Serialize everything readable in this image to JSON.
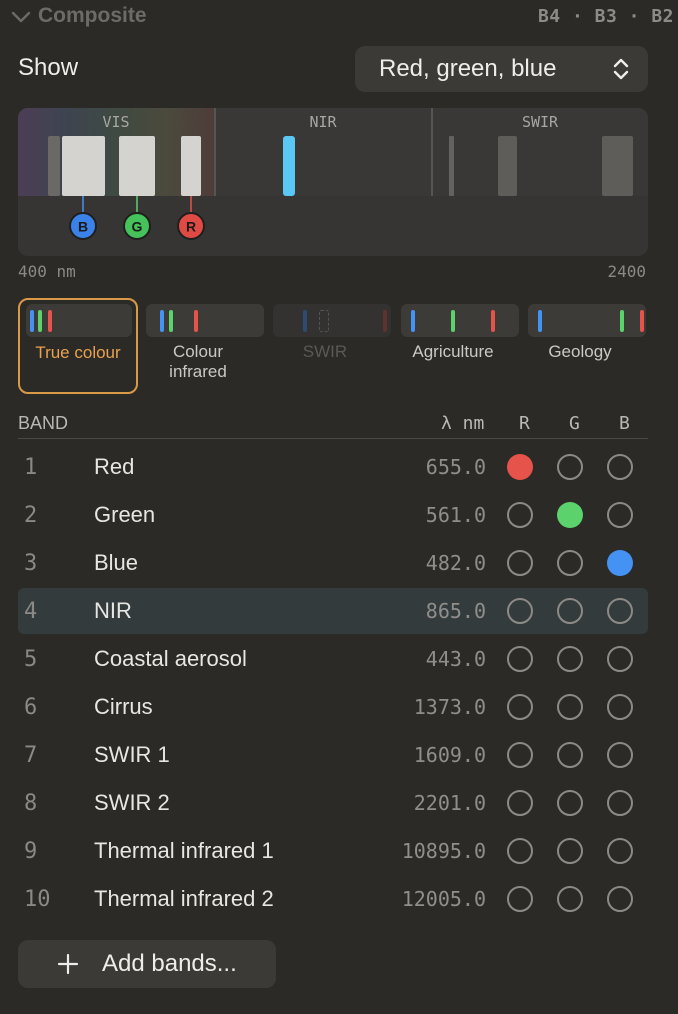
{
  "header": {
    "title": "Composite",
    "bands_summary": "B4 · B3 · B2"
  },
  "show": {
    "label": "Show",
    "selected": "Red, green, blue"
  },
  "spectrum": {
    "regions": [
      "VIS",
      "NIR",
      "SWIR"
    ],
    "min_label": "400 nm",
    "max_label": "2400",
    "channel_markers": [
      "B",
      "G",
      "R"
    ]
  },
  "presets": [
    {
      "label": "True colour",
      "active": true
    },
    {
      "label": "Colour infrared",
      "active": false
    },
    {
      "label": "SWIR",
      "active": false,
      "disabled": true
    },
    {
      "label": "Agriculture",
      "active": false
    },
    {
      "label": "Geology",
      "active": false
    }
  ],
  "table": {
    "headers": {
      "band": "BAND",
      "wavelength": "λ nm",
      "r": "R",
      "g": "G",
      "b": "B"
    },
    "rows": [
      {
        "num": "1",
        "name": "Red",
        "wl": "655.0",
        "assigned": "R"
      },
      {
        "num": "2",
        "name": "Green",
        "wl": "561.0",
        "assigned": "G"
      },
      {
        "num": "3",
        "name": "Blue",
        "wl": "482.0",
        "assigned": "B"
      },
      {
        "num": "4",
        "name": "NIR",
        "wl": "865.0",
        "assigned": "",
        "highlighted": true
      },
      {
        "num": "5",
        "name": "Coastal aerosol",
        "wl": "443.0",
        "assigned": ""
      },
      {
        "num": "6",
        "name": "Cirrus",
        "wl": "1373.0",
        "assigned": ""
      },
      {
        "num": "7",
        "name": "SWIR 1",
        "wl": "1609.0",
        "assigned": ""
      },
      {
        "num": "8",
        "name": "SWIR 2",
        "wl": "2201.0",
        "assigned": ""
      },
      {
        "num": "9",
        "name": "Thermal infrared 1",
        "wl": "10895.0",
        "assigned": ""
      },
      {
        "num": "10",
        "name": "Thermal infrared 2",
        "wl": "12005.0",
        "assigned": ""
      }
    ]
  },
  "add_button": {
    "label": "Add bands..."
  },
  "colors": {
    "red": "#e5534b",
    "green": "#5bd26b",
    "blue": "#4592f5",
    "nir": "#5ac8f2",
    "accent": "#e8a24d"
  },
  "icons": [
    "chevron-down-icon",
    "up-down-chevrons-icon",
    "plus-icon"
  ]
}
